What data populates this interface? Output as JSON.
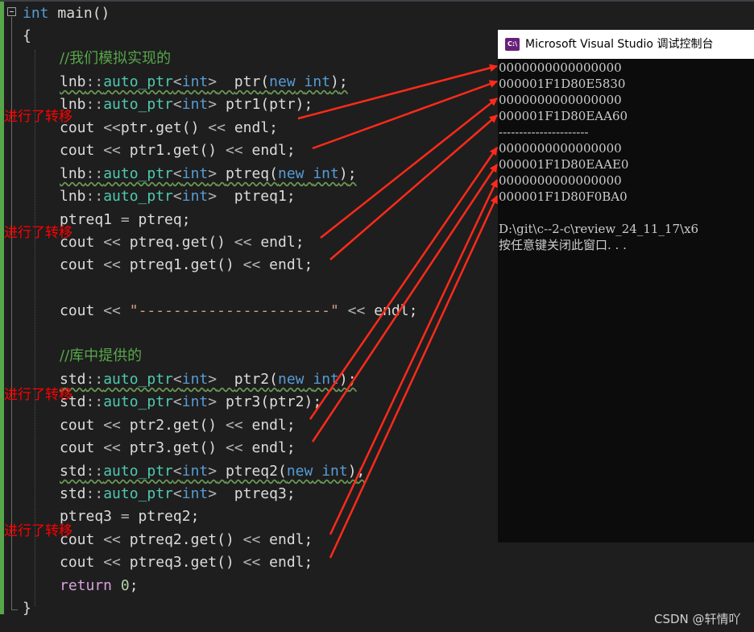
{
  "editor": {
    "signature": {
      "type": "int",
      "name": " main()"
    },
    "open_brace": "{",
    "close_brace": "}",
    "comment1": "//我们模拟实现的",
    "comment2": "//库中提供的",
    "ns_lnb": "lnb",
    "ns_std": "std",
    "scope": "::",
    "auto_ptr": "auto_ptr",
    "lt": "<",
    "gt": ">",
    "int_kw": "int",
    "new_kw": "new",
    "lparen": "(",
    "rparen": ")",
    "semi": ";",
    "cout": "cout",
    "shl": "<<",
    "endl": "endl",
    "get_call": ".get()",
    "assign": " = ",
    "var_ptr": "ptr",
    "var_ptr1": "ptr1",
    "var_ptreq": "ptreq",
    "var_ptreq1": "ptreq1",
    "var_ptr2": "ptr2",
    "var_ptr3": "ptr3",
    "var_ptreq2": "ptreq2",
    "var_ptreq3": "ptreq3",
    "separator_string": "\"----------------------\"",
    "return_kw": "return",
    "zero": "0"
  },
  "console": {
    "title": "Microsoft Visual Studio 调试控制台",
    "icon_text": "C:\\",
    "lines": [
      "0000000000000000",
      "000001F1D80E5830",
      "0000000000000000",
      "000001F1D80EAA60",
      "----------------------",
      "0000000000000000",
      "000001F1D80EAAE0",
      "0000000000000000",
      "000001F1D80F0BA0",
      "",
      "D:\\git\\c--2-c\\review_24_11_17\\x6",
      "按任意键关闭此窗口. . ."
    ]
  },
  "annotations": [
    {
      "text": "进行了转移"
    },
    {
      "text": "进行了转移"
    },
    {
      "text": "进行了转移"
    },
    {
      "text": "进行了转移"
    }
  ],
  "arrow_color": "#ff2a1a",
  "watermark": "CSDN @轩情吖"
}
